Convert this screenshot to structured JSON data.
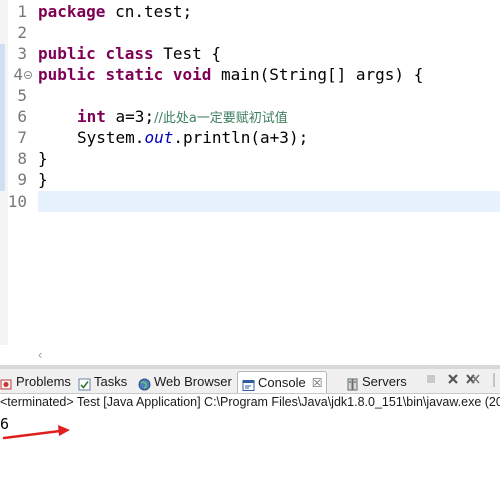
{
  "editor": {
    "line_numbers": [
      "1",
      "2",
      "3",
      "4",
      "5",
      "6",
      "7",
      "8",
      "9",
      "10"
    ],
    "lines": {
      "l1": {
        "kw": "package",
        "rest": " cn.test;"
      },
      "l3": {
        "kw1": "public",
        "kw2": "class",
        "rest": " Test {"
      },
      "l4": {
        "kw1": "public",
        "kw2": "static",
        "kw3": "void",
        "rest": " main(String[] args) {"
      },
      "l6": {
        "kw": "int",
        "code": " a=3;",
        "comment": "//此处a一定要赋初试值"
      },
      "l7": {
        "pre": "System.",
        "field": "out",
        "post": ".println(a+3);"
      },
      "l8": "}",
      "l9": "}"
    },
    "scroll_left_glyph": "‹"
  },
  "console": {
    "tabs": {
      "problems": "Problems",
      "tasks": "Tasks",
      "web_browser": "Web Browser",
      "console": "Console",
      "console_close": "☒",
      "servers": "Servers"
    },
    "status": "<terminated> Test [Java Application] C:\\Program Files\\Java\\jdk1.8.0_151\\bin\\javaw.exe (20",
    "output": "6"
  },
  "colors": {
    "keyword": "#7f0055",
    "comment": "#3f7f5f",
    "static_field": "#0000c0",
    "current_line": "#e8f2fe",
    "annotation_arrow": "#e02020"
  }
}
